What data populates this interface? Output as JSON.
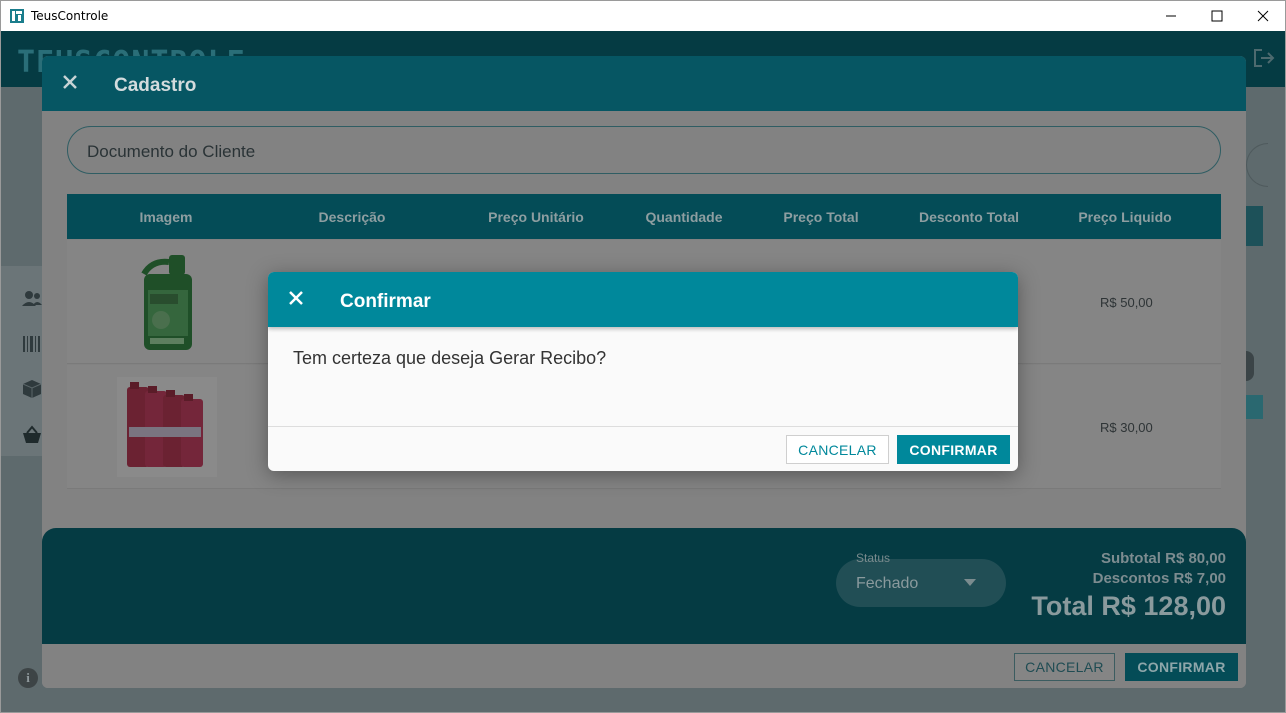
{
  "window": {
    "title": "TeusControle"
  },
  "app": {
    "logo_text": "TEUSCONTROLE"
  },
  "cadastro": {
    "title": "Cadastro",
    "document_placeholder": "Documento do Cliente",
    "table": {
      "headers": [
        "Imagem",
        "Descrição",
        "Preço Unitário",
        "Quantidade",
        "Preço Total",
        "Desconto Total",
        "Preço Liquido"
      ],
      "rows": [
        {
          "image": "motor-oil-bottle",
          "preco_liquido": "R$ 50,00"
        },
        {
          "image": "coolant-bottles-pack",
          "preco_liquido": "R$ 30,00"
        }
      ]
    },
    "footer": {
      "status_label": "Status",
      "status_value": "Fechado",
      "subtotal": "Subtotal R$ 80,00",
      "descontos": "Descontos R$ 7,00",
      "total": "Total R$ 128,00"
    },
    "actions": {
      "cancel_label": "CANCELAR",
      "confirm_label": "CONFIRMAR"
    }
  },
  "dialog": {
    "title": "Confirmar",
    "message": "Tem certeza que deseja Gerar Recibo?",
    "cancel_label": "CANCELAR",
    "confirm_label": "CONFIRMAR"
  },
  "colors": {
    "dialog_accent": "#00889b",
    "overlay_header": "#065663",
    "footer_dark": "#053b43"
  }
}
